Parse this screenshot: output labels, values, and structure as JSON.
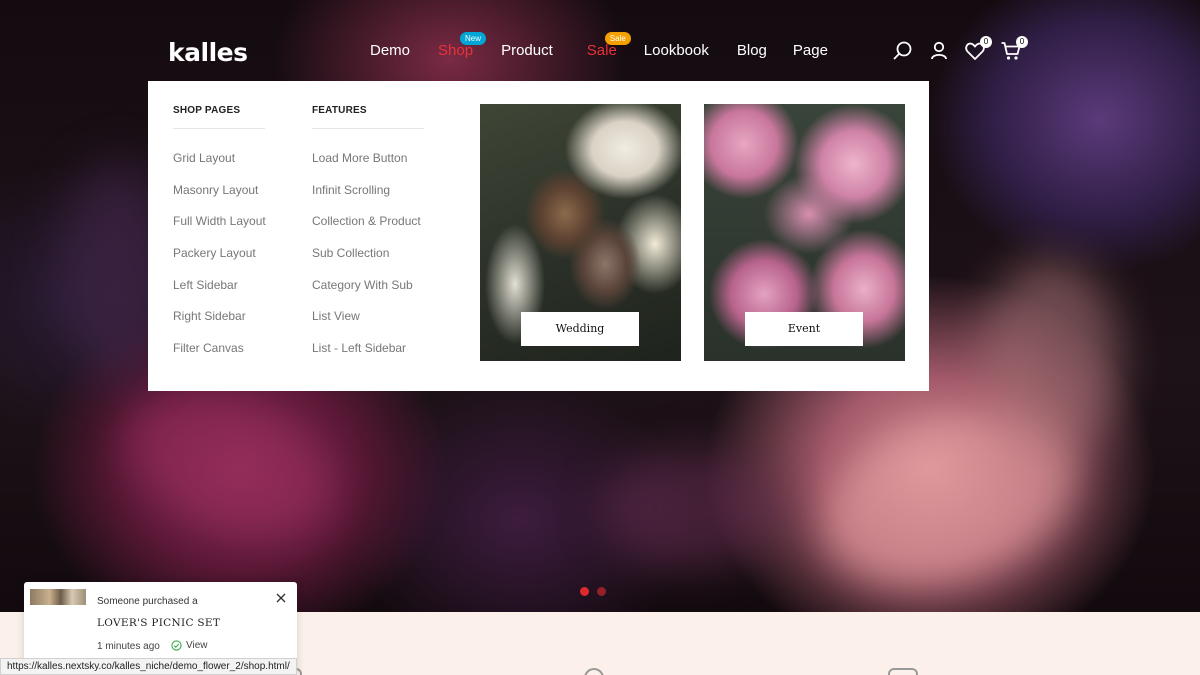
{
  "header": {
    "logo": "kalles",
    "nav": [
      {
        "label": "Demo",
        "color": "#ffffff"
      },
      {
        "label": "Shop",
        "color": "#e8313a",
        "badge": "New",
        "badge_color": "#00a6d6"
      },
      {
        "label": "Product",
        "color": "#ffffff"
      },
      {
        "label": "Sale",
        "color": "#e8313a",
        "badge": "Sale",
        "badge_color": "#f4a000"
      },
      {
        "label": "Lookbook",
        "color": "#ffffff"
      },
      {
        "label": "Blog",
        "color": "#ffffff"
      },
      {
        "label": "Page",
        "color": "#ffffff"
      }
    ],
    "wishlist_count": "0",
    "cart_count": "0",
    "icons": [
      "search-icon",
      "user-icon",
      "heart-icon",
      "cart-icon"
    ]
  },
  "mega_menu": {
    "col1": {
      "title": "SHOP PAGES",
      "items": [
        "Grid Layout",
        "Masonry Layout",
        "Full Width Layout",
        "Packery Layout",
        "Left Sidebar",
        "Right Sidebar",
        "Filter Canvas"
      ]
    },
    "col2": {
      "title": "FEATURES",
      "items": [
        "Load More Button",
        "Infinit Scrolling",
        "Collection & Product",
        "Sub Collection",
        "Category With Sub",
        "List View",
        "List - Left Sidebar"
      ]
    },
    "promos": [
      {
        "label": "Wedding"
      },
      {
        "label": "Event"
      }
    ]
  },
  "slider": {
    "active_index": 0,
    "count": 2
  },
  "popup": {
    "text": "Someone purchased a",
    "product": "LOVER'S PICNIC SET",
    "time": "1 minutes ago",
    "view": "View"
  },
  "statusbar": {
    "url": "https://kalles.nextsky.co/kalles_niche/demo_flower_2/shop.html/"
  },
  "colors": {
    "accent_red": "#e8313a",
    "badge_new": "#00a6d6",
    "badge_sale": "#f4a000",
    "slider_dot": "#e0292d"
  }
}
